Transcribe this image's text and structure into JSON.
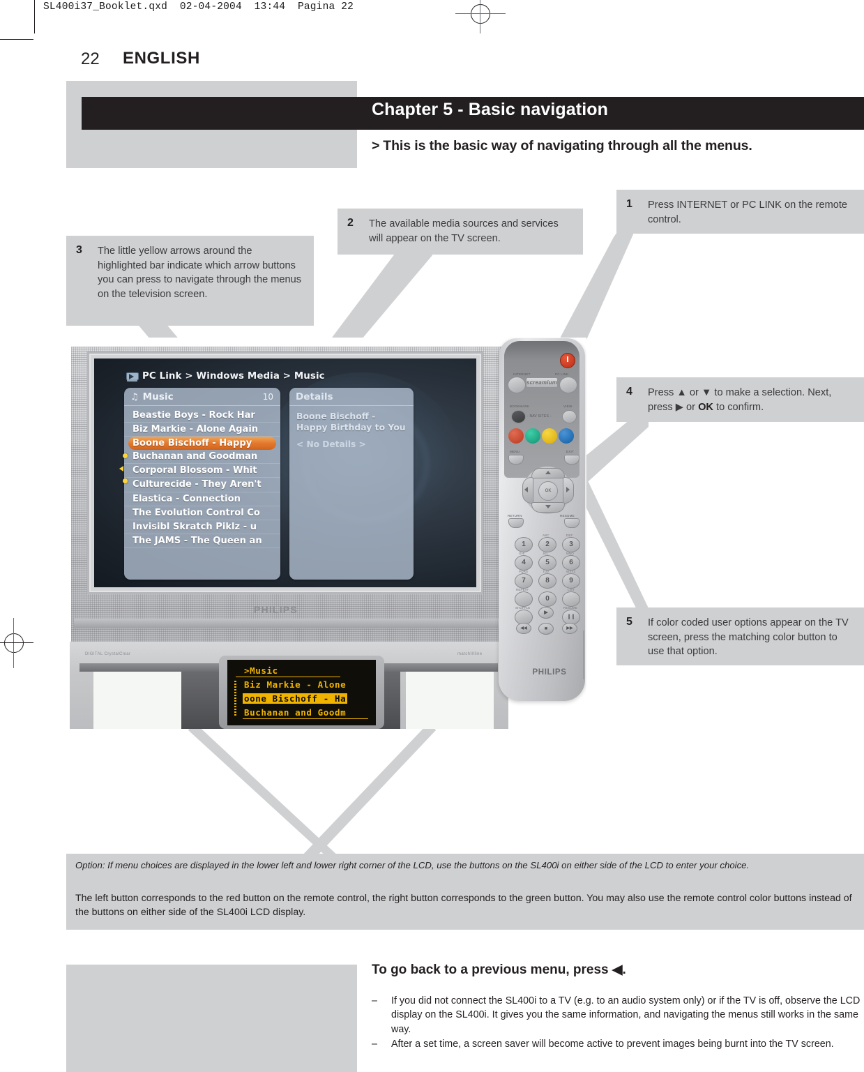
{
  "file_header": "SL400i37_Booklet.qxd  02-04-2004  13:44  Pagina 22",
  "page": {
    "number": "22",
    "language": "ENGLISH"
  },
  "chapter": {
    "title": "Chapter 5 - Basic navigation",
    "marker": ">",
    "subtitle": "This is the basic way of navigating through all the menus."
  },
  "steps": [
    {
      "num": "1",
      "text": "Press INTERNET or PC LINK on the remote control."
    },
    {
      "num": "2",
      "text": "The available media sources and services will appear on the TV screen."
    },
    {
      "num": "3",
      "text": "The little yellow arrows around the highlighted bar indicate which arrow buttons you can press to navigate through the menus on the television screen."
    },
    {
      "num": "4",
      "pre": "Press ",
      "up": "▲",
      "mid1": " or ",
      "down": "▼",
      "mid2": " to make a selection. Next, press ",
      "right": "▶",
      "mid3": " or ",
      "ok": "OK",
      "post": " to confirm."
    },
    {
      "num": "5",
      "text": "If color coded user options appear on the TV screen, press the matching color button to use that option."
    }
  ],
  "tv_screen": {
    "breadcrumb": "PC Link > Windows Media > Music",
    "breadcrumb_icon": "pc-link-icon",
    "left_panel": {
      "title": "Music",
      "count": "10",
      "note_icon": "music-note-icon",
      "tracks": [
        "Beastie Boys - Rock Har",
        "Biz Markie - Alone Again",
        "Boone Bischoff - Happy",
        "Buchanan and Goodman",
        "Corporal Blossom - Whit",
        "Culturecide - They Aren't",
        "Elastica - Connection",
        "The Evolution Control Co",
        "Invisibl Skratch Piklz - u",
        "The JAMS - The Queen an"
      ],
      "selected_index": 2
    },
    "right_panel": {
      "title": "Details",
      "item": "Boone Bischoff - Happy Birthday to You",
      "no_details": "< No Details >"
    }
  },
  "tv_hardware": {
    "brand": "PHILIPS",
    "left_badge": "DIGITAL  CrystalClear",
    "right_badge": "matchIIIline"
  },
  "lcd_display": {
    "header": ">Music",
    "header_icon": "device-icon",
    "rows": [
      "Biz Markie - Alone",
      "oone Bischoff - Ha",
      "Buchanan and Goodm"
    ],
    "selected_index": 1,
    "color": "#f0b400"
  },
  "remote": {
    "brand": "PHILIPS",
    "chip_label": "screamium",
    "power_icon": "power-icon",
    "labels": {
      "internet": "INTERNET",
      "pc_link": "PC LINK",
      "bookmark": "BOOKMARK",
      "view": "VIEW",
      "nav": "- NAV   SITES -"
    },
    "color_buttons": [
      {
        "name": "red-button",
        "color": "#cf4a32"
      },
      {
        "name": "green-button",
        "color": "#1fae8c"
      },
      {
        "name": "yellow-button",
        "color": "#efc319"
      },
      {
        "name": "blue-button",
        "color": "#1f74c0"
      }
    ],
    "soft_labels": {
      "menu": "MENU",
      "exit": "EXIT",
      "return": "RETURN",
      "resume": "RESUME"
    },
    "ok_label": "OK",
    "keys": [
      {
        "digit": "1",
        "sub": ""
      },
      {
        "digit": "2",
        "sub": "ABC"
      },
      {
        "digit": "3",
        "sub": "DEF"
      },
      {
        "digit": "4",
        "sub": "GHI"
      },
      {
        "digit": "5",
        "sub": "JKL"
      },
      {
        "digit": "6",
        "sub": "MNO"
      },
      {
        "digit": "7",
        "sub": "PQRS"
      },
      {
        "digit": "8",
        "sub": "TUV"
      },
      {
        "digit": "9",
        "sub": "WXYZ"
      },
      {
        "digit": "0",
        "sub": ""
      }
    ],
    "transport": {
      "repeat": "REPEAT",
      "list": "LIST",
      "shuffle": "SHUFFLE",
      "resume": "RESUME",
      "play": "▶",
      "pause": "❙❙",
      "stop": "■",
      "prev": "◀◀",
      "next": "▶▶"
    }
  },
  "option_note": "Option: If menu choices are displayed in the lower left and lower right corner of the LCD, use the buttons on the SL400i on either side of the LCD to enter your choice.",
  "footer_paragraph": "The left button corresponds to the red button on the remote control, the right button corresponds to the green button. You may also use the remote control color buttons instead of the buttons on either side of the SL400i LCD display.",
  "back_section": {
    "heading": "To go back to a previous menu, press ◀.",
    "bullets": [
      {
        "dash": "–",
        "text": "If you did not connect the SL400i to a TV (e.g. to an audio system only) or if the TV is off, observe the LCD display on the SL400i. It gives you the same information, and navigating the menus still works in the same way."
      },
      {
        "dash": "–",
        "text": "After a set time, a screen saver will become active to prevent images being burnt into the TV screen."
      }
    ]
  }
}
